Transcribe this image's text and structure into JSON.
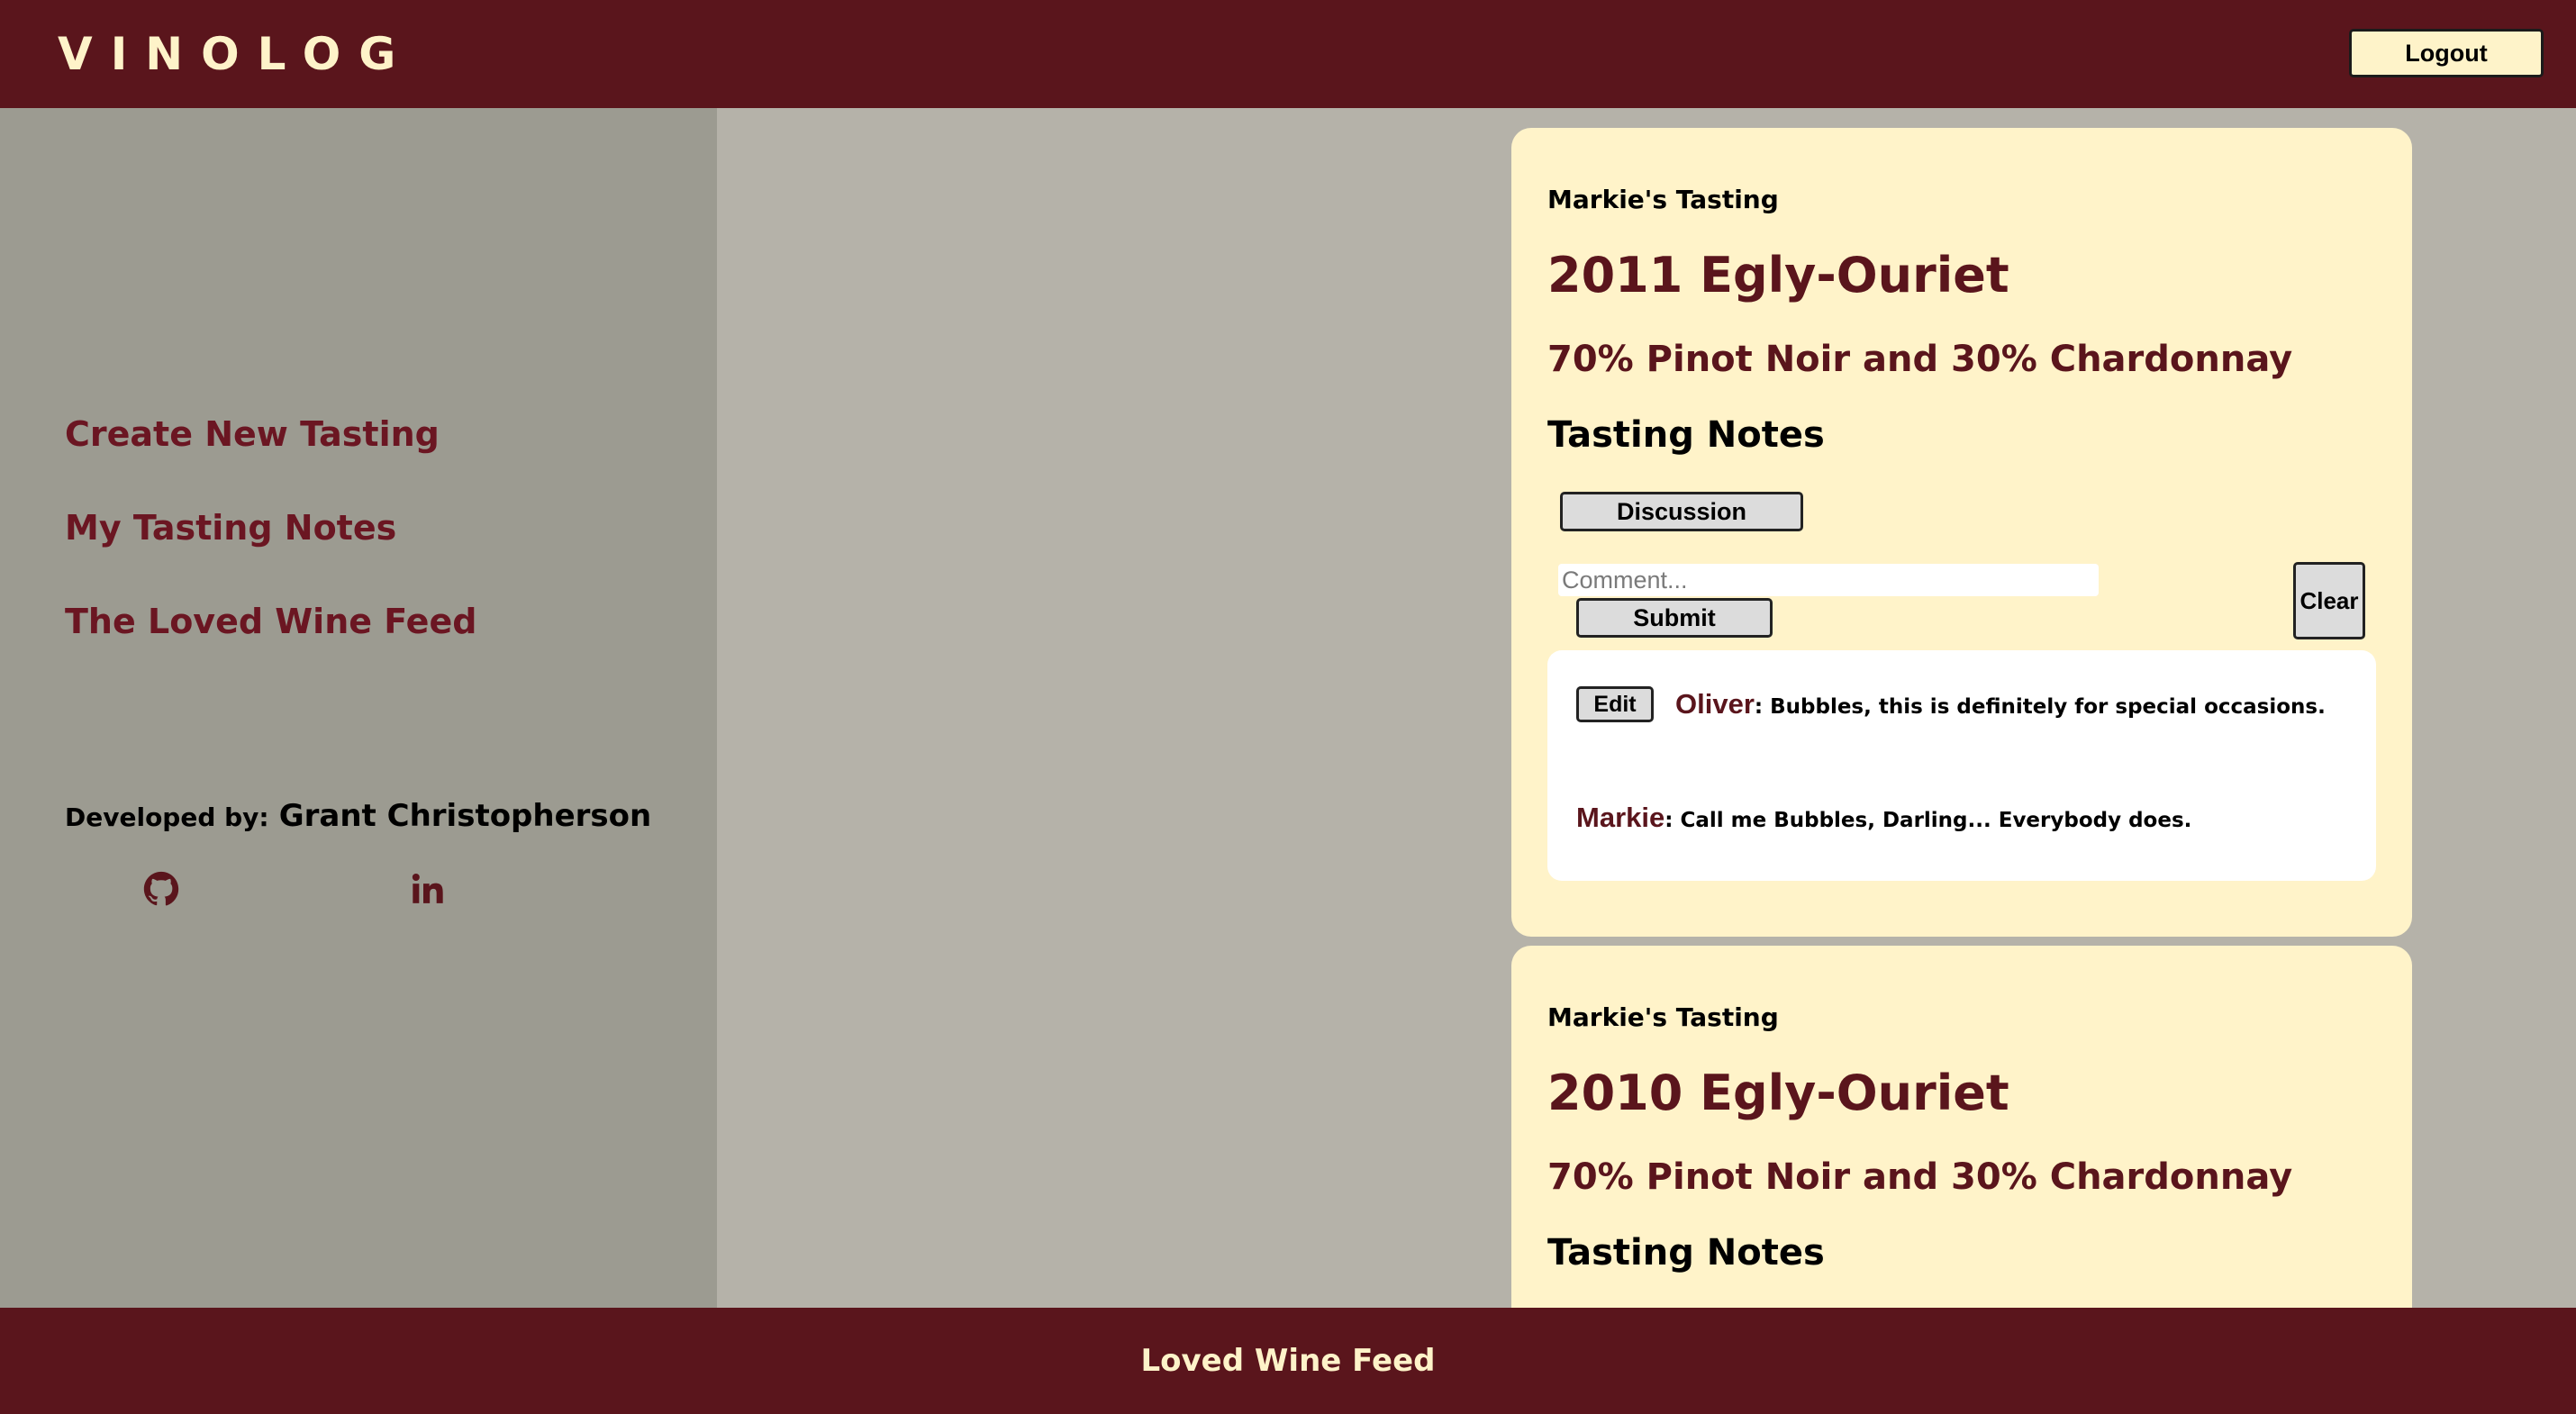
{
  "app": {
    "logo": "VINOLOG",
    "logout_label": "Logout"
  },
  "sidebar": {
    "nav": [
      {
        "label": "Create New Tasting"
      },
      {
        "label": "My Tasting Notes"
      },
      {
        "label": "The Loved Wine Feed"
      }
    ],
    "developer_prefix": "Developed by:",
    "developer_name": "Grant Christopherson",
    "social_icons": [
      "github-icon",
      "linkedin-icon"
    ]
  },
  "feed": {
    "cards": [
      {
        "owner": "Markie's Tasting",
        "wine": "2011 Egly-Ouriet",
        "varietal": "70% Pinot Noir and 30% Chardonnay",
        "notes_heading": "Tasting Notes",
        "discussion_label": "Discussion",
        "comment_placeholder": "Comment...",
        "submit_label": "Submit",
        "clear_label": "Clear",
        "comments": [
          {
            "edit_label": "Edit",
            "author": "Oliver",
            "text": "Bubbles, this is definitely for special occasions."
          },
          {
            "author": "Markie",
            "text": "Call me Bubbles, Darling... Everybody does."
          }
        ]
      },
      {
        "owner": "Markie's Tasting",
        "wine": "2010 Egly-Ouriet",
        "varietal": "70% Pinot Noir and 30% Chardonnay",
        "notes_heading": "Tasting Notes"
      }
    ]
  },
  "footer": {
    "title": "Loved Wine Feed"
  },
  "colors": {
    "brand": "#5a151c",
    "cream": "#fef3c9",
    "sidebar": "#9c9b91",
    "background": "#b5b2a9"
  }
}
